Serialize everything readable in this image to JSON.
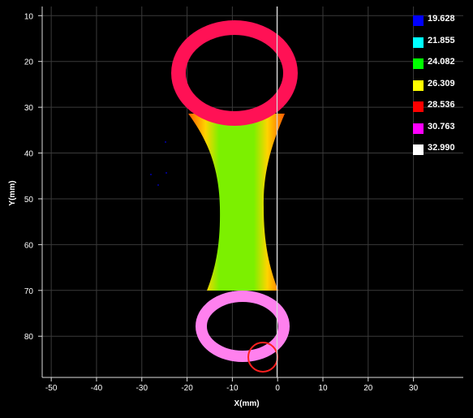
{
  "plot": {
    "x_axis_label": "X(mm)",
    "y_axis_label": "Y(mm)",
    "x_ticks": [
      -50,
      -40,
      -30,
      -20,
      -10,
      0,
      10,
      20,
      30
    ],
    "y_ticks": [
      10,
      20,
      30,
      40,
      50,
      60,
      70,
      80
    ],
    "x_range": [
      -52,
      41
    ],
    "y_range": [
      8,
      89
    ]
  },
  "legend": {
    "items": [
      {
        "label": "19.628",
        "color": "#0000ff"
      },
      {
        "label": "21.855",
        "color": "#00ffff"
      },
      {
        "label": "24.082",
        "color": "#00ff00"
      },
      {
        "label": "26.309",
        "color": "#ffff00"
      },
      {
        "label": "28.536",
        "color": "#ff0000"
      },
      {
        "label": "30.763",
        "color": "#ff00ff"
      },
      {
        "label": "32.990",
        "color": "#ffffff"
      }
    ]
  },
  "part": {
    "top_ring_color": "#ff1155",
    "shaft_edge_color": "#ff5a00",
    "shaft_mid_color": "#ffd400",
    "shaft_core_color": "#7cf000",
    "bottom_ring_color": "#ff80ee",
    "marker_color": "#ff2020"
  }
}
